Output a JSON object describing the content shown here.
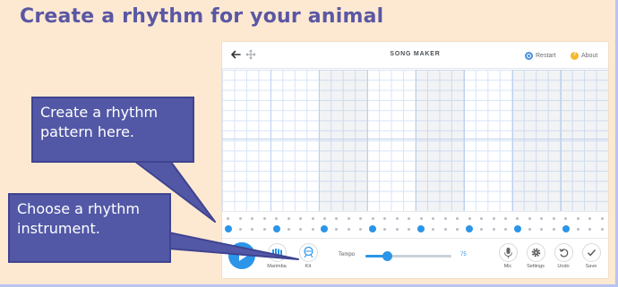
{
  "slide": {
    "title": "Create a rhythm for your animal"
  },
  "app": {
    "title": "SONG MAKER",
    "header": {
      "back_icon": "arrow-left-icon",
      "move_icon": "move-icon",
      "restart_label": "Restart",
      "about_label": "About"
    },
    "controls": {
      "play_icon": "play-icon",
      "instrument_label": "Marimba",
      "rhythm_instrument_label": "Kit",
      "tempo_label": "Tempo",
      "tempo_value": "75",
      "tempo_fraction": 0.25,
      "mic_label": "Mic",
      "settings_label": "Settings",
      "undo_label": "Undo",
      "save_label": "Save"
    },
    "rhythm_beats": [
      1,
      5,
      9,
      13,
      17,
      21,
      25,
      29
    ]
  },
  "callouts": {
    "rhythm": "Create a rhythm pattern here.",
    "instrument": "Choose a rhythm instrument."
  },
  "colors": {
    "accent": "#2b95e8",
    "callout": "#5258a6",
    "title": "#5a57a3",
    "background": "#fde9d2"
  }
}
